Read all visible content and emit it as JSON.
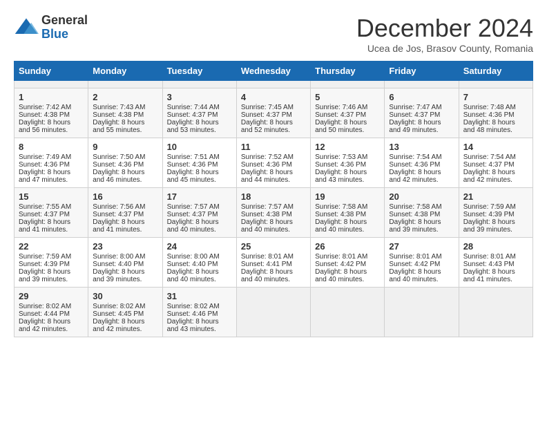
{
  "header": {
    "logo_general": "General",
    "logo_blue": "Blue",
    "title": "December 2024",
    "subtitle": "Ucea de Jos, Brasov County, Romania"
  },
  "calendar": {
    "days_of_week": [
      "Sunday",
      "Monday",
      "Tuesday",
      "Wednesday",
      "Thursday",
      "Friday",
      "Saturday"
    ],
    "weeks": [
      [
        {
          "day": "",
          "empty": true
        },
        {
          "day": "",
          "empty": true
        },
        {
          "day": "",
          "empty": true
        },
        {
          "day": "",
          "empty": true
        },
        {
          "day": "",
          "empty": true
        },
        {
          "day": "",
          "empty": true
        },
        {
          "day": "",
          "empty": true
        }
      ],
      [
        {
          "day": "1",
          "sunrise": "7:42 AM",
          "sunset": "4:38 PM",
          "daylight": "8 hours and 56 minutes."
        },
        {
          "day": "2",
          "sunrise": "7:43 AM",
          "sunset": "4:38 PM",
          "daylight": "8 hours and 55 minutes."
        },
        {
          "day": "3",
          "sunrise": "7:44 AM",
          "sunset": "4:37 PM",
          "daylight": "8 hours and 53 minutes."
        },
        {
          "day": "4",
          "sunrise": "7:45 AM",
          "sunset": "4:37 PM",
          "daylight": "8 hours and 52 minutes."
        },
        {
          "day": "5",
          "sunrise": "7:46 AM",
          "sunset": "4:37 PM",
          "daylight": "8 hours and 50 minutes."
        },
        {
          "day": "6",
          "sunrise": "7:47 AM",
          "sunset": "4:37 PM",
          "daylight": "8 hours and 49 minutes."
        },
        {
          "day": "7",
          "sunrise": "7:48 AM",
          "sunset": "4:36 PM",
          "daylight": "8 hours and 48 minutes."
        }
      ],
      [
        {
          "day": "8",
          "sunrise": "7:49 AM",
          "sunset": "4:36 PM",
          "daylight": "8 hours and 47 minutes."
        },
        {
          "day": "9",
          "sunrise": "7:50 AM",
          "sunset": "4:36 PM",
          "daylight": "8 hours and 46 minutes."
        },
        {
          "day": "10",
          "sunrise": "7:51 AM",
          "sunset": "4:36 PM",
          "daylight": "8 hours and 45 minutes."
        },
        {
          "day": "11",
          "sunrise": "7:52 AM",
          "sunset": "4:36 PM",
          "daylight": "8 hours and 44 minutes."
        },
        {
          "day": "12",
          "sunrise": "7:53 AM",
          "sunset": "4:36 PM",
          "daylight": "8 hours and 43 minutes."
        },
        {
          "day": "13",
          "sunrise": "7:54 AM",
          "sunset": "4:36 PM",
          "daylight": "8 hours and 42 minutes."
        },
        {
          "day": "14",
          "sunrise": "7:54 AM",
          "sunset": "4:37 PM",
          "daylight": "8 hours and 42 minutes."
        }
      ],
      [
        {
          "day": "15",
          "sunrise": "7:55 AM",
          "sunset": "4:37 PM",
          "daylight": "8 hours and 41 minutes."
        },
        {
          "day": "16",
          "sunrise": "7:56 AM",
          "sunset": "4:37 PM",
          "daylight": "8 hours and 41 minutes."
        },
        {
          "day": "17",
          "sunrise": "7:57 AM",
          "sunset": "4:37 PM",
          "daylight": "8 hours and 40 minutes."
        },
        {
          "day": "18",
          "sunrise": "7:57 AM",
          "sunset": "4:38 PM",
          "daylight": "8 hours and 40 minutes."
        },
        {
          "day": "19",
          "sunrise": "7:58 AM",
          "sunset": "4:38 PM",
          "daylight": "8 hours and 40 minutes."
        },
        {
          "day": "20",
          "sunrise": "7:58 AM",
          "sunset": "4:38 PM",
          "daylight": "8 hours and 39 minutes."
        },
        {
          "day": "21",
          "sunrise": "7:59 AM",
          "sunset": "4:39 PM",
          "daylight": "8 hours and 39 minutes."
        }
      ],
      [
        {
          "day": "22",
          "sunrise": "7:59 AM",
          "sunset": "4:39 PM",
          "daylight": "8 hours and 39 minutes."
        },
        {
          "day": "23",
          "sunrise": "8:00 AM",
          "sunset": "4:40 PM",
          "daylight": "8 hours and 39 minutes."
        },
        {
          "day": "24",
          "sunrise": "8:00 AM",
          "sunset": "4:40 PM",
          "daylight": "8 hours and 40 minutes."
        },
        {
          "day": "25",
          "sunrise": "8:01 AM",
          "sunset": "4:41 PM",
          "daylight": "8 hours and 40 minutes."
        },
        {
          "day": "26",
          "sunrise": "8:01 AM",
          "sunset": "4:42 PM",
          "daylight": "8 hours and 40 minutes."
        },
        {
          "day": "27",
          "sunrise": "8:01 AM",
          "sunset": "4:42 PM",
          "daylight": "8 hours and 40 minutes."
        },
        {
          "day": "28",
          "sunrise": "8:01 AM",
          "sunset": "4:43 PM",
          "daylight": "8 hours and 41 minutes."
        }
      ],
      [
        {
          "day": "29",
          "sunrise": "8:02 AM",
          "sunset": "4:44 PM",
          "daylight": "8 hours and 42 minutes."
        },
        {
          "day": "30",
          "sunrise": "8:02 AM",
          "sunset": "4:45 PM",
          "daylight": "8 hours and 42 minutes."
        },
        {
          "day": "31",
          "sunrise": "8:02 AM",
          "sunset": "4:46 PM",
          "daylight": "8 hours and 43 minutes."
        },
        {
          "day": "",
          "empty": true
        },
        {
          "day": "",
          "empty": true
        },
        {
          "day": "",
          "empty": true
        },
        {
          "day": "",
          "empty": true
        }
      ]
    ],
    "labels": {
      "sunrise": "Sunrise:",
      "sunset": "Sunset:",
      "daylight": "Daylight:"
    }
  }
}
